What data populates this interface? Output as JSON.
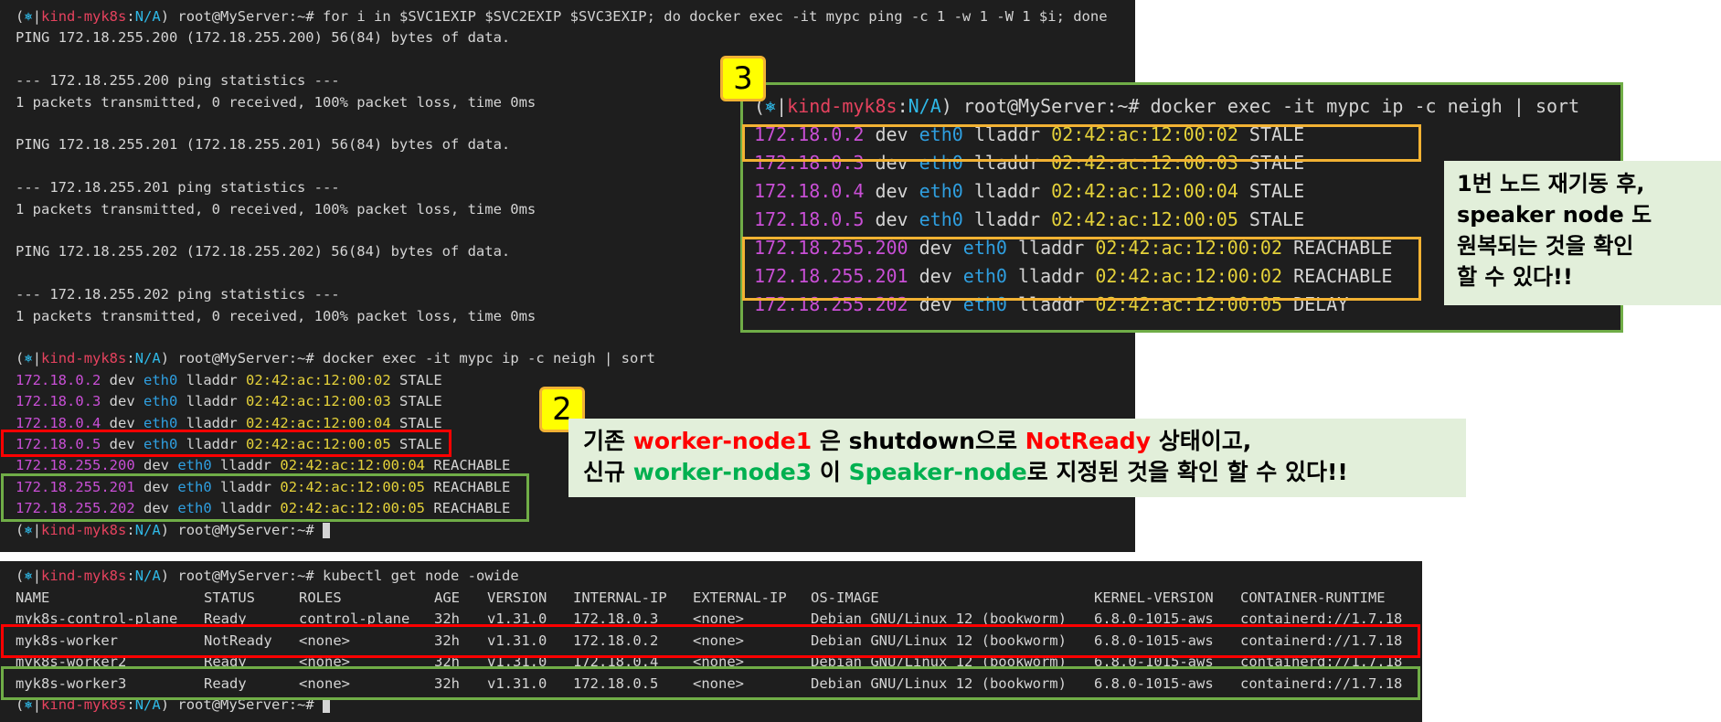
{
  "colors": {
    "terminal_bg": "#1e1e1e",
    "ip": "#c94fd6",
    "dev": "#2f9fe0",
    "mac": "#e5d23a",
    "ctx": "#e5425e",
    "ns": "#2fb8e6",
    "red_box": "#ff0000",
    "green_box": "#70ad47",
    "orange_box": "#f2b233",
    "callout_bg": "#e2efda",
    "badge_bg": "#ffff00"
  },
  "prompt": {
    "open": "(",
    "icon": "⎈",
    "sep": "|",
    "ctx": "kind-myk8s",
    "colon": ":",
    "ns": "N/A",
    "close": ")",
    "userhost": " root@MyServer:~# "
  },
  "term1": {
    "cmd1": "for i in $SVC1EXIP $SVC2EXIP $SVC3EXIP; do docker exec -it mypc ping -c 1 -w 1 -W 1 $i; done",
    "lines": [
      "PING 172.18.255.200 (172.18.255.200) 56(84) bytes of data.",
      "",
      "--- 172.18.255.200 ping statistics ---",
      "1 packets transmitted, 0 received, 100% packet loss, time 0ms",
      "",
      "PING 172.18.255.201 (172.18.255.201) 56(84) bytes of data.",
      "",
      "--- 172.18.255.201 ping statistics ---",
      "1 packets transmitted, 0 received, 100% packet loss, time 0ms",
      "",
      "PING 172.18.255.202 (172.18.255.202) 56(84) bytes of data.",
      "",
      "--- 172.18.255.202 ping statistics ---",
      "1 packets transmitted, 0 received, 100% packet loss, time 0ms",
      ""
    ],
    "cmd2": "docker exec -it mypc ip -c neigh | sort",
    "neigh": [
      {
        "ip": "172.18.0.2",
        "mac": "02:42:ac:12:00:02",
        "state": "STALE"
      },
      {
        "ip": "172.18.0.3",
        "mac": "02:42:ac:12:00:03",
        "state": "STALE"
      },
      {
        "ip": "172.18.0.4",
        "mac": "02:42:ac:12:00:04",
        "state": "STALE"
      },
      {
        "ip": "172.18.0.5",
        "mac": "02:42:ac:12:00:05",
        "state": "STALE"
      },
      {
        "ip": "172.18.255.200",
        "mac": "02:42:ac:12:00:04",
        "state": "REACHABLE"
      },
      {
        "ip": "172.18.255.201",
        "mac": "02:42:ac:12:00:05",
        "state": "REACHABLE"
      },
      {
        "ip": "172.18.255.202",
        "mac": "02:42:ac:12:00:05",
        "state": "REACHABLE"
      }
    ],
    "dev_word": "dev",
    "eth": "eth0",
    "lladdr": "lladdr"
  },
  "term3": {
    "cmd": "docker exec -it mypc ip -c neigh | sort",
    "neigh": [
      {
        "ip": "172.18.0.2",
        "mac": "02:42:ac:12:00:02",
        "state": "STALE"
      },
      {
        "ip": "172.18.0.3",
        "mac": "02:42:ac:12:00:03",
        "state": "STALE"
      },
      {
        "ip": "172.18.0.4",
        "mac": "02:42:ac:12:00:04",
        "state": "STALE"
      },
      {
        "ip": "172.18.0.5",
        "mac": "02:42:ac:12:00:05",
        "state": "STALE"
      },
      {
        "ip": "172.18.255.200",
        "mac": "02:42:ac:12:00:02",
        "state": "REACHABLE"
      },
      {
        "ip": "172.18.255.201",
        "mac": "02:42:ac:12:00:02",
        "state": "REACHABLE"
      },
      {
        "ip": "172.18.255.202",
        "mac": "02:42:ac:12:00:05",
        "state": "DELAY"
      }
    ]
  },
  "badge2": "2",
  "badge3": "3",
  "callout2": {
    "l1_a": "기존 ",
    "l1_b": "worker-node1",
    "l1_c": " 은 shutdown으로 ",
    "l1_d": "NotReady",
    "l1_e": " 상태이고,",
    "l2_a": "신규 ",
    "l2_b": "worker-node3",
    "l2_c": " 이 ",
    "l2_d": "Speaker-node",
    "l2_e": "로 지정된 것을 확인 할 수 있다!!"
  },
  "callout3": [
    "1번 노드 재기동 후,",
    "speaker node 도",
    "원복되는 것을 확인",
    "할 수 있다!!"
  ],
  "term2": {
    "cmd": "kubectl get node -owide",
    "headers": [
      "NAME",
      "STATUS",
      "ROLES",
      "AGE",
      "VERSION",
      "INTERNAL-IP",
      "EXTERNAL-IP",
      "OS-IMAGE",
      "KERNEL-VERSION",
      "CONTAINER-RUNTIME"
    ],
    "rows": [
      [
        "myk8s-control-plane",
        "Ready",
        "control-plane",
        "32h",
        "v1.31.0",
        "172.18.0.3",
        "<none>",
        "Debian GNU/Linux 12 (bookworm)",
        "6.8.0-1015-aws",
        "containerd://1.7.18"
      ],
      [
        "myk8s-worker",
        "NotReady",
        "<none>",
        "32h",
        "v1.31.0",
        "172.18.0.2",
        "<none>",
        "Debian GNU/Linux 12 (bookworm)",
        "6.8.0-1015-aws",
        "containerd://1.7.18"
      ],
      [
        "myk8s-worker2",
        "Ready",
        "<none>",
        "32h",
        "v1.31.0",
        "172.18.0.4",
        "<none>",
        "Debian GNU/Linux 12 (bookworm)",
        "6.8.0-1015-aws",
        "containerd://1.7.18"
      ],
      [
        "myk8s-worker3",
        "Ready",
        "<none>",
        "32h",
        "v1.31.0",
        "172.18.0.5",
        "<none>",
        "Debian GNU/Linux 12 (bookworm)",
        "6.8.0-1015-aws",
        "containerd://1.7.18"
      ]
    ]
  }
}
